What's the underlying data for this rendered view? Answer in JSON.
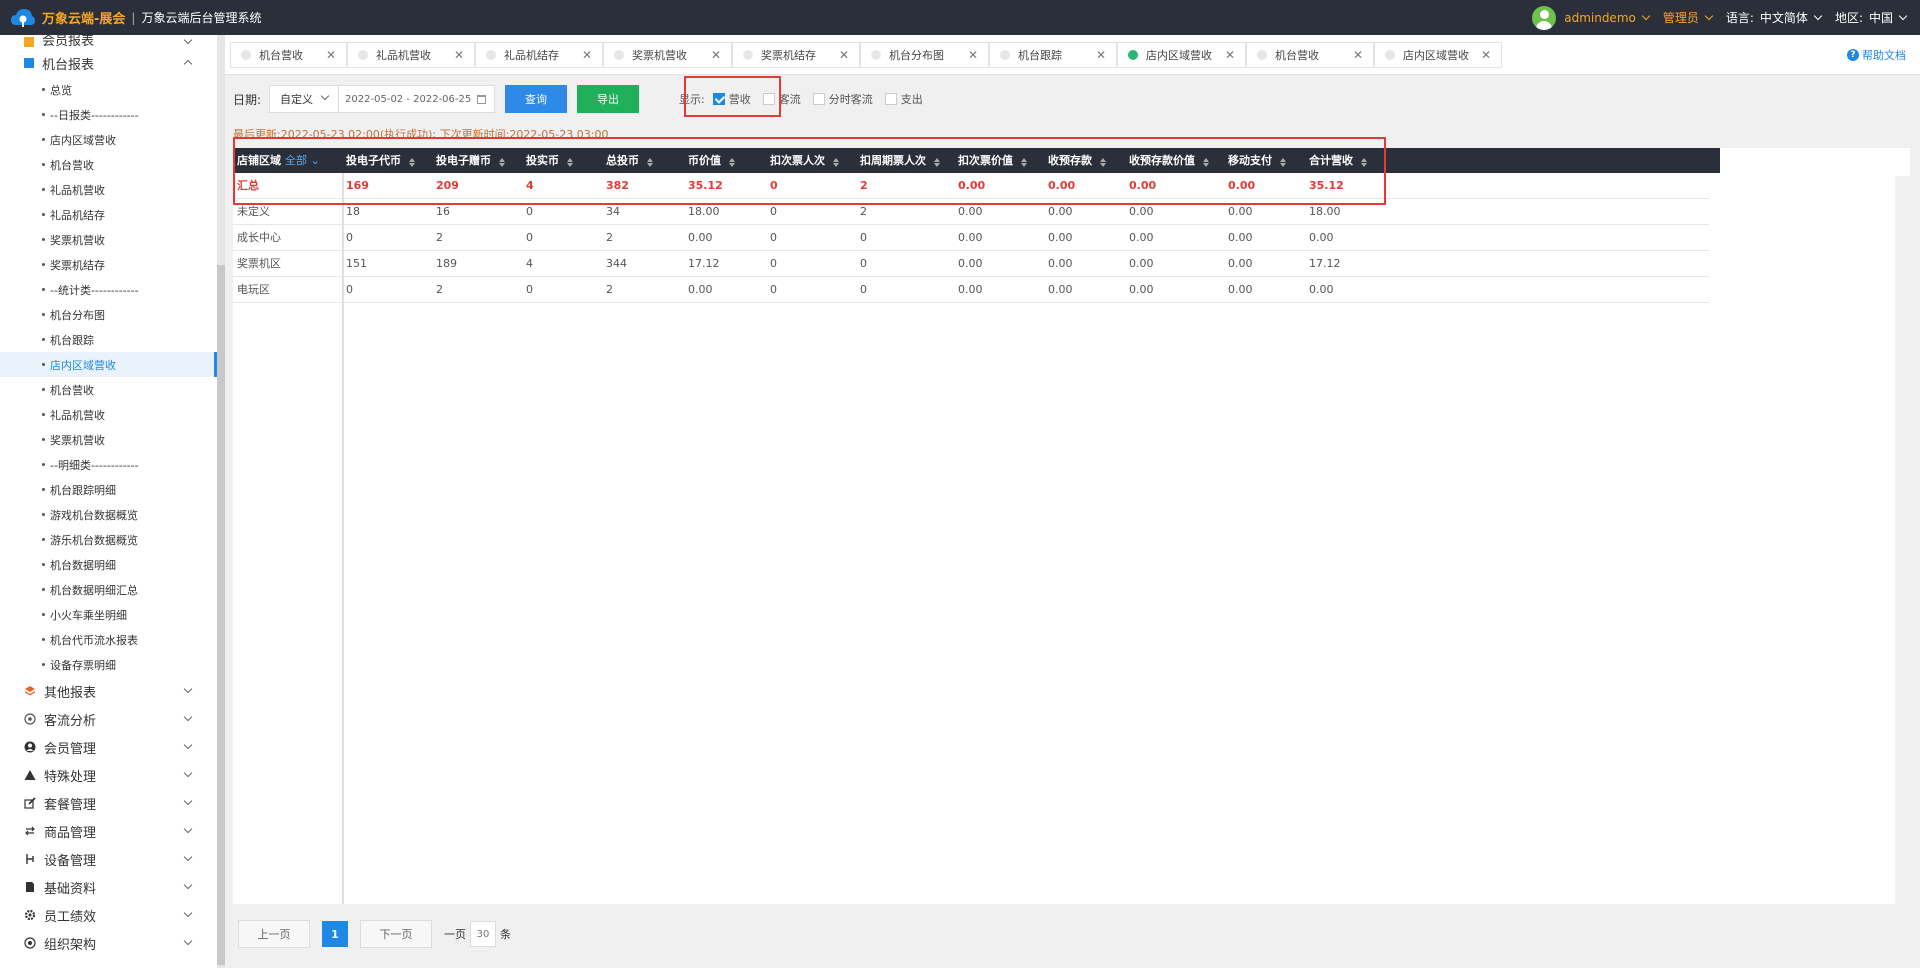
{
  "app": {
    "brand": "万象云端-展会",
    "subtitle": "万象云端后台管理系统"
  },
  "topbar": {
    "user": "admindemo",
    "role": "管理员",
    "language_label": "语言:",
    "language_value": "中文简体",
    "region_label": "地区:",
    "region_value": "中国"
  },
  "sidebar": {
    "top_items": [
      {
        "label": "会员报表"
      },
      {
        "label": "机台报表"
      }
    ],
    "sub_items": [
      {
        "label": "总览"
      },
      {
        "label": "--日报类------------"
      },
      {
        "label": "店内区域营收"
      },
      {
        "label": "机台营收"
      },
      {
        "label": "礼品机营收"
      },
      {
        "label": "礼品机结存"
      },
      {
        "label": "奖票机营收"
      },
      {
        "label": "奖票机结存"
      },
      {
        "label": "--统计类------------"
      },
      {
        "label": "机台分布图"
      },
      {
        "label": "机台跟踪"
      },
      {
        "label": "店内区域营收"
      },
      {
        "label": "机台营收"
      },
      {
        "label": "礼品机营收"
      },
      {
        "label": "奖票机营收"
      },
      {
        "label": "--明细类------------"
      },
      {
        "label": "机台跟踪明细"
      },
      {
        "label": "游戏机台数据概览"
      },
      {
        "label": "游乐机台数据概览"
      },
      {
        "label": "机台数据明细"
      },
      {
        "label": "机台数据明细汇总"
      },
      {
        "label": "小火车乘坐明细"
      },
      {
        "label": "机台代币流水报表"
      },
      {
        "label": "设备存票明细"
      }
    ],
    "main_items": [
      {
        "label": "其他报表"
      },
      {
        "label": "客流分析"
      },
      {
        "label": "会员管理"
      },
      {
        "label": "特殊处理"
      },
      {
        "label": "套餐管理"
      },
      {
        "label": "商品管理"
      },
      {
        "label": "设备管理"
      },
      {
        "label": "基础资料"
      },
      {
        "label": "员工绩效"
      },
      {
        "label": "组织架构"
      }
    ]
  },
  "tabs": [
    {
      "label": "机台营收"
    },
    {
      "label": "礼品机营收"
    },
    {
      "label": "礼品机结存"
    },
    {
      "label": "奖票机营收"
    },
    {
      "label": "奖票机结存"
    },
    {
      "label": "机台分布图"
    },
    {
      "label": "机台跟踪"
    },
    {
      "label": "店内区域营收"
    },
    {
      "label": "机台营收"
    },
    {
      "label": "店内区域营收"
    }
  ],
  "help_label": "帮助文档",
  "filter": {
    "date_label": "日期:",
    "mode": "自定义",
    "range": "2022-05-02 - 2022-06-25",
    "query_label": "查询",
    "export_label": "导出",
    "show_label": "显示:",
    "options": [
      {
        "label": "营收",
        "checked": true
      },
      {
        "label": "客流",
        "checked": false
      },
      {
        "label": "分时客流",
        "checked": false
      },
      {
        "label": "支出",
        "checked": false
      }
    ]
  },
  "update_text": "最后更新:2022-05-23 02:00(执行成功); 下次更新时间:2022-05-23 03:00",
  "table": {
    "region_header": "店铺区域",
    "region_filter": "全部",
    "columns": [
      "投电子代币",
      "投电子赠币",
      "投实币",
      "总投币",
      "币价值",
      "扣次票人次",
      "扣周期票人次",
      "扣次票价值",
      "收预存款",
      "收预存款价值",
      "移动支付",
      "合计营收"
    ],
    "rows": [
      {
        "name": "汇总",
        "total": true,
        "cells": [
          "169",
          "209",
          "4",
          "382",
          "35.12",
          "0",
          "2",
          "0.00",
          "0.00",
          "0.00",
          "0.00",
          "35.12"
        ]
      },
      {
        "name": "未定义",
        "total": false,
        "cells": [
          "18",
          "16",
          "0",
          "34",
          "18.00",
          "0",
          "2",
          "0.00",
          "0.00",
          "0.00",
          "0.00",
          "18.00"
        ]
      },
      {
        "name": "成长中心",
        "total": false,
        "cells": [
          "0",
          "2",
          "0",
          "2",
          "0.00",
          "0",
          "0",
          "0.00",
          "0.00",
          "0.00",
          "0.00",
          "0.00"
        ]
      },
      {
        "name": "奖票机区",
        "total": false,
        "cells": [
          "151",
          "189",
          "4",
          "344",
          "17.12",
          "0",
          "0",
          "0.00",
          "0.00",
          "0.00",
          "0.00",
          "17.12"
        ]
      },
      {
        "name": "电玩区",
        "total": false,
        "cells": [
          "0",
          "2",
          "0",
          "2",
          "0.00",
          "0",
          "0",
          "0.00",
          "0.00",
          "0.00",
          "0.00",
          "0.00"
        ]
      }
    ]
  },
  "pager": {
    "prev": "上一页",
    "page": "1",
    "next": "下一页",
    "per_page_prefix": "一页",
    "per_page": "30",
    "per_page_suffix": "条"
  },
  "colors": {
    "topbar": "#2b2f3a",
    "brand": "#f5a623",
    "primary": "#1e88e5",
    "export": "#20b05a",
    "total_row": "#e53935",
    "highlight_box": "#e53935"
  }
}
